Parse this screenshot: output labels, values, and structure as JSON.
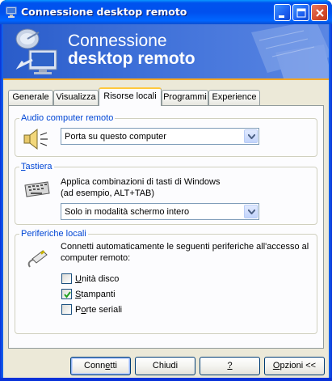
{
  "window": {
    "title": "Connessione desktop remoto"
  },
  "banner": {
    "line1": "Connessione",
    "line2": "desktop remoto"
  },
  "tabs": [
    {
      "label": "Generale",
      "active": false
    },
    {
      "label": "Visualizza",
      "active": false
    },
    {
      "label": "Risorse locali",
      "active": true
    },
    {
      "label": "Programmi",
      "active": false
    },
    {
      "label": "Experience",
      "active": false
    }
  ],
  "audio": {
    "group_label": "Audio computer remoto",
    "selected": "Porta su questo computer"
  },
  "keyboard": {
    "group_label_underlined": "T",
    "group_label_rest": "astiera",
    "description_line1": "Applica combinazioni di tasti di Windows",
    "description_line2": "(ad esempio, ALT+TAB)",
    "selected": "Solo in modalità schermo intero"
  },
  "devices": {
    "group_label": "Periferiche locali",
    "description_line1": "Connetti automaticamente le seguenti periferiche all'accesso al",
    "description_line2": "computer remoto:",
    "items": [
      {
        "label_ul": "U",
        "label_rest": "nità disco",
        "checked": false
      },
      {
        "label_ul": "S",
        "label_rest": "tampanti",
        "checked": true
      },
      {
        "label_pre": "P",
        "label_ul": "o",
        "label_rest": "rte seriali",
        "checked": false
      }
    ]
  },
  "buttons": {
    "connect_pre": "Conn",
    "connect_ul": "e",
    "connect_rest": "tti",
    "close": "Chiudi",
    "help": "?",
    "options_ul": "O",
    "options_rest": "pzioni <<"
  },
  "colors": {
    "titlebar": "#0053ee",
    "accent_orange": "#f5a623",
    "group_label_blue": "#0046d5",
    "dialog_bg": "#ece9d8"
  }
}
